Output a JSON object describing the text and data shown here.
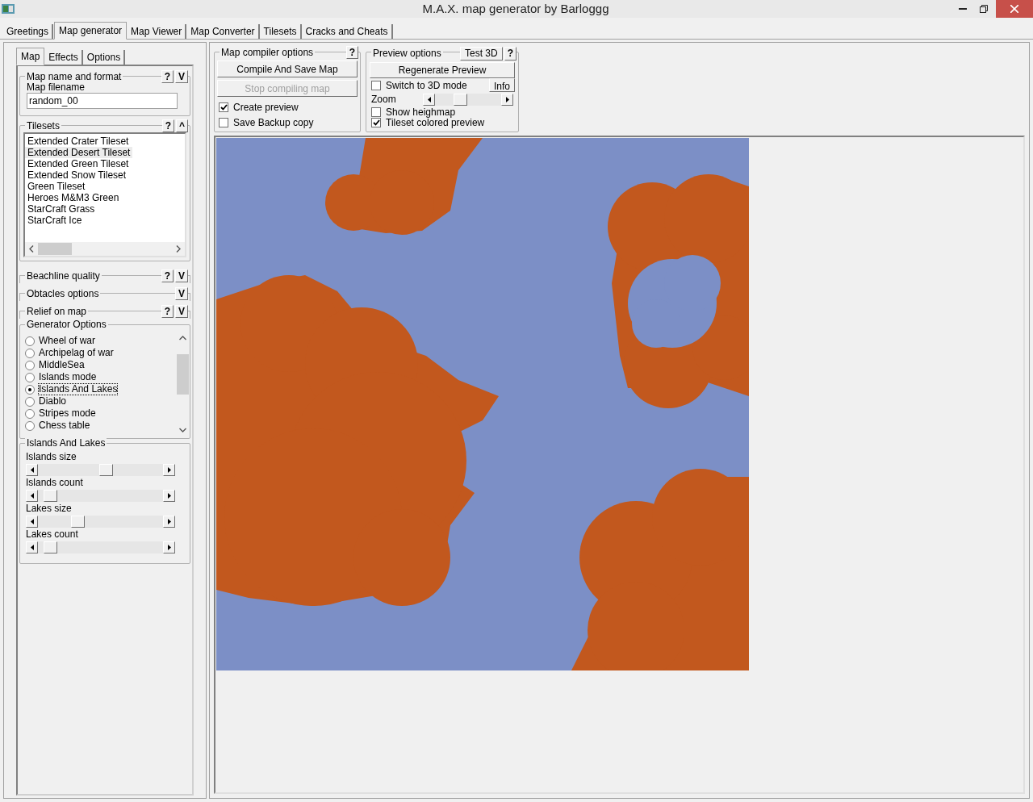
{
  "window": {
    "title": "M.A.X. map generator by Barloggg"
  },
  "main_tabs": [
    {
      "label": "Greetings",
      "selected": false
    },
    {
      "label": "Map generator",
      "selected": true
    },
    {
      "label": "Map Viewer",
      "selected": false
    },
    {
      "label": "Map Converter",
      "selected": false
    },
    {
      "label": "Tilesets",
      "selected": false
    },
    {
      "label": "Cracks and Cheats",
      "selected": false
    }
  ],
  "sub_tabs": [
    {
      "label": "Map",
      "selected": true
    },
    {
      "label": "Effects",
      "selected": false
    },
    {
      "label": "Options",
      "selected": false
    }
  ],
  "map_name_group": {
    "title": "Map name and format",
    "help": "?",
    "toggle": "V",
    "field_label": "Map filename",
    "filename": "random_00"
  },
  "tilesets_group": {
    "title": "Tilesets",
    "help": "?",
    "toggle": "^",
    "items": [
      {
        "label": "Extended Crater Tileset",
        "selected": false
      },
      {
        "label": "Extended Desert Tileset",
        "selected": true
      },
      {
        "label": "Extended Green Tileset",
        "selected": false
      },
      {
        "label": "Extended Snow Tileset",
        "selected": false
      },
      {
        "label": "Green Tileset",
        "selected": false
      },
      {
        "label": "Heroes M&M3 Green",
        "selected": false
      },
      {
        "label": "StarCraft Grass",
        "selected": false
      },
      {
        "label": "StarCraft Ice",
        "selected": false
      }
    ]
  },
  "collapsed_groups": [
    {
      "title": "Beachline quality",
      "help": "?",
      "toggle": "V"
    },
    {
      "title": "Obtacles options",
      "toggle": "V"
    },
    {
      "title": "Relief on map",
      "help": "?",
      "toggle": "V"
    }
  ],
  "generator_options": {
    "title": "Generator Options",
    "modes": [
      {
        "label": "Wheel of war",
        "selected": false
      },
      {
        "label": "Archipelag of war",
        "selected": false
      },
      {
        "label": "MiddleSea",
        "selected": false
      },
      {
        "label": "Islands mode",
        "selected": false
      },
      {
        "label": "Islands And Lakes",
        "selected": true
      },
      {
        "label": "Diablo",
        "selected": false
      },
      {
        "label": "Stripes mode",
        "selected": false
      },
      {
        "label": "Chess table",
        "selected": false
      }
    ]
  },
  "mode_settings": {
    "title": "Islands And Lakes",
    "sliders": [
      {
        "label": "Islands size",
        "level": 0.55
      },
      {
        "label": "Islands count",
        "level": 0.05
      },
      {
        "label": "Lakes size",
        "level": 0.3
      },
      {
        "label": "Lakes count",
        "level": 0.05
      }
    ]
  },
  "compiler": {
    "title": "Map compiler options",
    "help": "?",
    "buttons": [
      {
        "label": "Compile And Save Map",
        "disabled": false
      },
      {
        "label": "Stop compiling map",
        "disabled": true
      }
    ],
    "checks": [
      {
        "label": "Create preview",
        "checked": true
      },
      {
        "label": "Save Backup copy",
        "checked": false
      }
    ]
  },
  "preview": {
    "title": "Preview options",
    "test_button": "Test 3D",
    "help": "?",
    "regenerate": "Regenerate Preview",
    "mode_check": {
      "label": "Switch to 3D mode",
      "checked": false
    },
    "info_button": "Info",
    "zoom": {
      "label": "Zoom",
      "level": 0.35
    },
    "checks": [
      {
        "label": "Show heighmap",
        "checked": false
      },
      {
        "label": "Tileset colored preview",
        "checked": true
      }
    ]
  }
}
